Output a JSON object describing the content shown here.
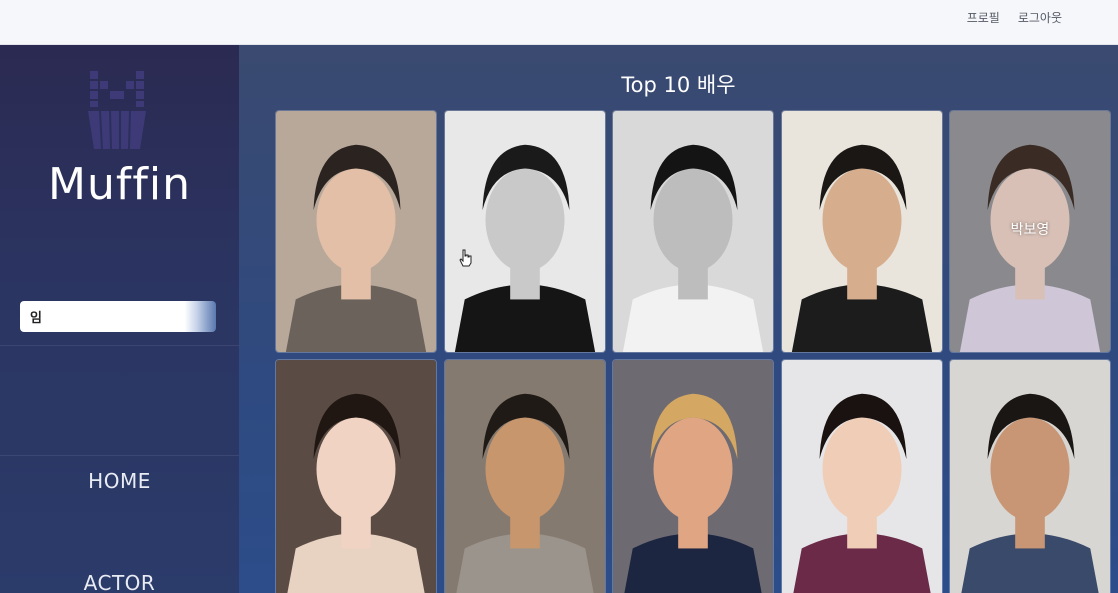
{
  "topnav": {
    "profile": "프로필",
    "logout": "로그아웃"
  },
  "sidebar": {
    "logo_text": "Muffin",
    "search": {
      "value": "임",
      "placeholder": ""
    },
    "nav": [
      {
        "label": "HOME"
      },
      {
        "label": "ACTOR"
      }
    ]
  },
  "main": {
    "title": "Top 10 배우",
    "hover_label": "박보영",
    "actors": [
      {
        "bg": "#b8a89a",
        "skin": "#e2bfa6",
        "hair": "#2a2320",
        "shirt": "#6b625c"
      },
      {
        "bg": "#e8e8e8",
        "skin": "#c9c9c9",
        "hair": "#1a1a1a",
        "shirt": "#151515"
      },
      {
        "bg": "#d9d9d9",
        "skin": "#bdbdbd",
        "hair": "#141414",
        "shirt": "#f2f2f2"
      },
      {
        "bg": "#e9e4dc",
        "skin": "#d6ad8d",
        "hair": "#1b1714",
        "shirt": "#1c1c1c"
      },
      {
        "bg": "#8a8a8e",
        "skin": "#d8c0b6",
        "hair": "#3a2c24",
        "shirt": "#cfc6d8"
      },
      {
        "bg": "#5a4c44",
        "skin": "#f0d3c2",
        "hair": "#201612",
        "shirt": "#e8d2c2"
      },
      {
        "bg": "#857a70",
        "skin": "#c8966c",
        "hair": "#201a16",
        "shirt": "#9b948c"
      },
      {
        "bg": "#6e6a72",
        "skin": "#e0a684",
        "hair": "#d4a862",
        "shirt": "#1c2640"
      },
      {
        "bg": "#e6e6e8",
        "skin": "#f0cdb6",
        "hair": "#1a1210",
        "shirt": "#6a2a48"
      },
      {
        "bg": "#d8d6d2",
        "skin": "#c89674",
        "hair": "#1a1614",
        "shirt": "#3a4a6a"
      }
    ]
  },
  "colors": {
    "sidebar_bg": "#2b2f5c",
    "main_bg": "#2f4a80",
    "topbar_bg": "#f6f7fa"
  }
}
